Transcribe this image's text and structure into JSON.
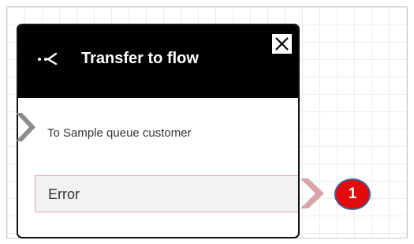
{
  "block": {
    "title": "Transfer to flow",
    "header_icon": "transfer-to-flow-icon",
    "close_icon": "close-icon",
    "description": "To Sample queue customer",
    "branches": [
      {
        "label": "Error"
      }
    ]
  },
  "callout": {
    "number": "1",
    "color": "#e20b0b"
  },
  "colors": {
    "header_bg": "#000000",
    "connector": "#8c8c8c",
    "error_connector": "#d9a3a8"
  }
}
